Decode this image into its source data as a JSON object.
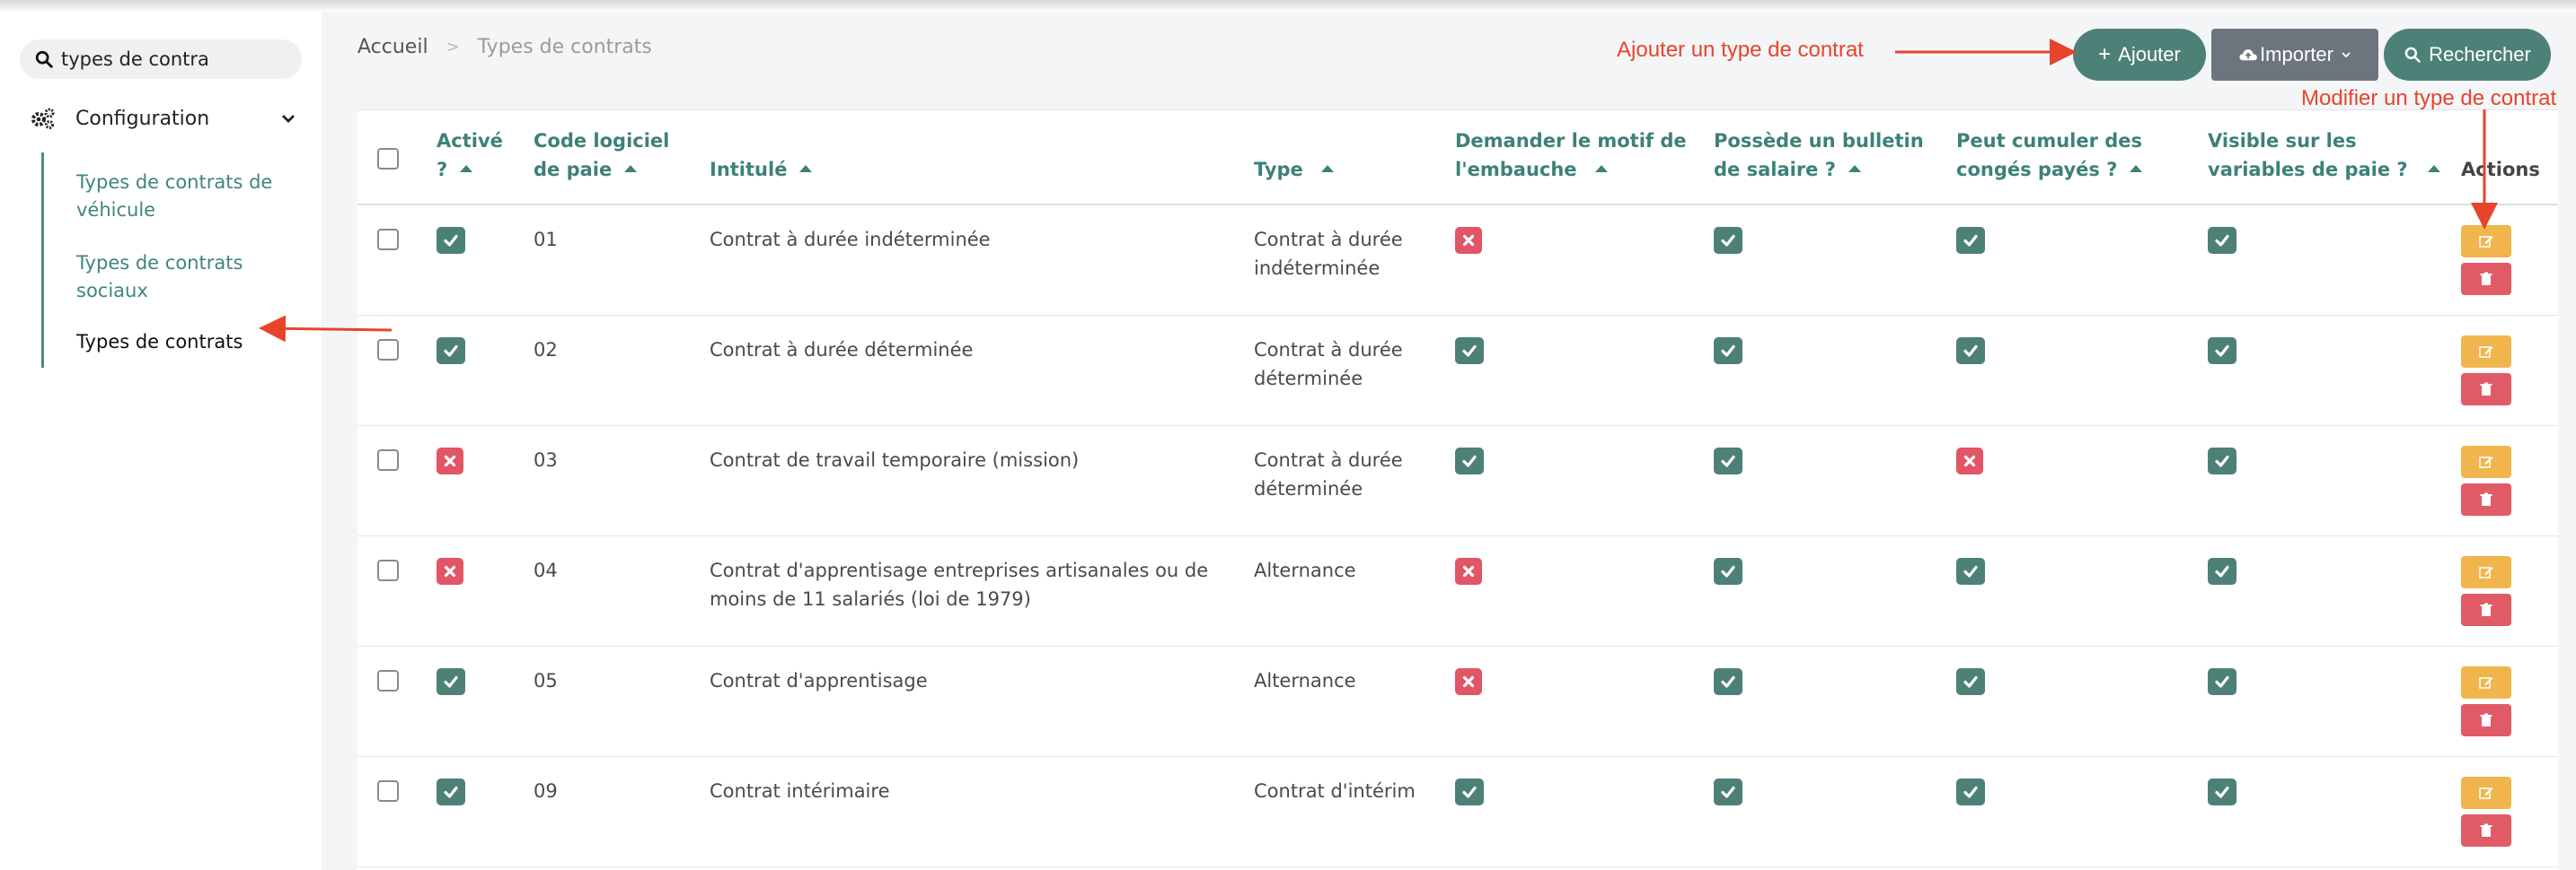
{
  "sidebar": {
    "search_value": "types de contra",
    "config_label": "Configuration",
    "items": [
      {
        "label": "Types de contrats de véhicule"
      },
      {
        "label": "Types de contrats sociaux"
      },
      {
        "label": "Types de contrats"
      }
    ]
  },
  "breadcrumb": {
    "home": "Accueil",
    "sep": ">",
    "current": "Types de contrats"
  },
  "toolbar": {
    "add_label": "Ajouter",
    "import_label": "Importer",
    "search_label": "Rechercher"
  },
  "annotations": {
    "add": "Ajouter un type  de contrat",
    "edit": "Modifier un type de contrat"
  },
  "colors": {
    "accent": "#4d8177",
    "danger": "#e25566",
    "warning": "#f0b64d",
    "annotation": "#e7442c"
  },
  "table": {
    "headers": {
      "active": [
        "Activé",
        "?"
      ],
      "code": [
        "Code logiciel",
        "de paie"
      ],
      "title": [
        "Intitulé"
      ],
      "type": [
        "Type"
      ],
      "reason": [
        "Demander le motif de",
        "l'embauche"
      ],
      "payslip": [
        "Possède un bulletin",
        "de salaire ?"
      ],
      "leave": [
        "Peut cumuler des",
        "congés payés ?"
      ],
      "visible": [
        "Visible sur les",
        "variables de paie ?"
      ],
      "actions": "Actions"
    },
    "rows": [
      {
        "active": true,
        "code": "01",
        "title": [
          "Contrat à durée indéterminée"
        ],
        "type": [
          "Contrat à durée",
          "indéterminée"
        ],
        "reason": false,
        "payslip": true,
        "leave": true,
        "visible": true
      },
      {
        "active": true,
        "code": "02",
        "title": [
          "Contrat à durée déterminée"
        ],
        "type": [
          "Contrat à durée",
          "déterminée"
        ],
        "reason": true,
        "payslip": true,
        "leave": true,
        "visible": true
      },
      {
        "active": false,
        "code": "03",
        "title": [
          "Contrat de travail temporaire (mission)"
        ],
        "type": [
          "Contrat à durée",
          "déterminée"
        ],
        "reason": true,
        "payslip": true,
        "leave": false,
        "visible": true
      },
      {
        "active": false,
        "code": "04",
        "title": [
          "Contrat d'apprentisage entreprises artisanales ou de",
          "moins de 11 salariés (loi de 1979)"
        ],
        "type": [
          "Alternance"
        ],
        "reason": false,
        "payslip": true,
        "leave": true,
        "visible": true
      },
      {
        "active": true,
        "code": "05",
        "title": [
          "Contrat d'apprentisage"
        ],
        "type": [
          "Alternance"
        ],
        "reason": false,
        "payslip": true,
        "leave": true,
        "visible": true
      },
      {
        "active": true,
        "code": "09",
        "title": [
          "Contrat intérimaire"
        ],
        "type": [
          "Contrat d'intérim"
        ],
        "reason": true,
        "payslip": true,
        "leave": true,
        "visible": true
      }
    ]
  }
}
